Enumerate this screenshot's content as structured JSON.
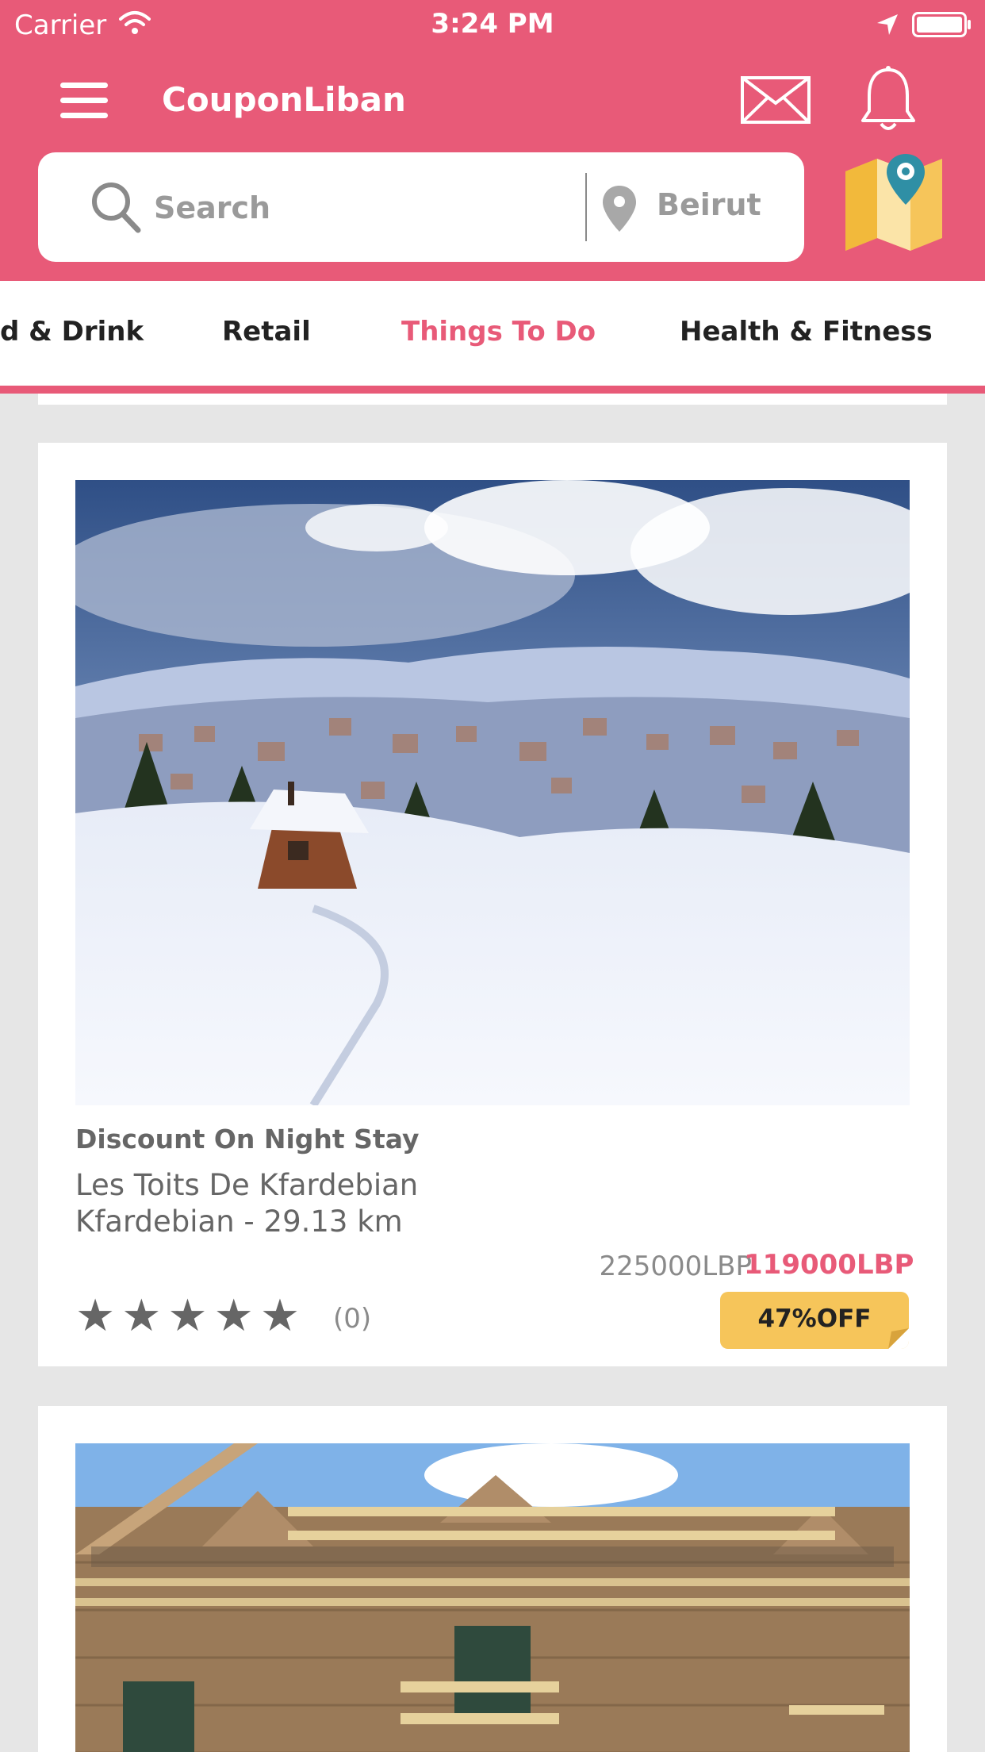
{
  "status_bar": {
    "carrier": "Carrier",
    "time": "3:24 PM"
  },
  "header": {
    "title": "CouponLiban",
    "menu_icon": "menu-icon",
    "mail_icon": "mail-icon",
    "notifications_icon": "bell-icon",
    "map_icon": "map-icon"
  },
  "search": {
    "placeholder": "Search",
    "location": "Beirut"
  },
  "tabs": [
    {
      "label": "d & Drink"
    },
    {
      "label": "Retail"
    },
    {
      "label": "Things To Do",
      "active": true
    },
    {
      "label": "Health & Fitness"
    }
  ],
  "deals": [
    {
      "title": "Discount On Night Stay",
      "merchant": "Les Toits De Kfardebian",
      "location": "Kfardebian - 29.13 km",
      "old_price": "225000LBP",
      "new_price": "119000LBP",
      "rating": 0,
      "reviews": "(0)",
      "discount": "47%OFF"
    }
  ],
  "colors": {
    "brand": "#e85a78",
    "badge": "#f6c55a",
    "map_pin": "#2f8fa5",
    "background": "#e6e6e6"
  }
}
